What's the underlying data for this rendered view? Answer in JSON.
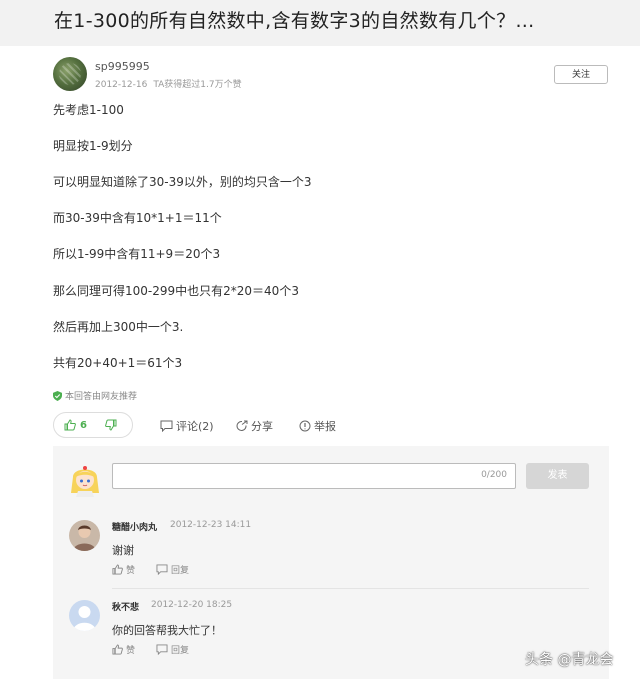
{
  "question": {
    "title": "在1-300的所有自然数中,含有数字3的自然数有几个？..."
  },
  "author": {
    "name": "sp995995",
    "date": "2012-12-16",
    "stats": "TA获得超过1.7万个赞"
  },
  "follow_label": "关注",
  "answer_lines": [
    "先考虑1-100",
    "明显按1-9划分",
    "可以明显知道除了30-39以外，别的均只含一个3",
    "而30-39中含有10*1+1＝11个",
    "所以1-99中含有11+9＝20个3",
    "那么同理可得100-299中也只有2*20＝40个3",
    "然后再加上300中一个3.",
    "共有20+40+1＝61个3"
  ],
  "recommend_note": "本回答由网友推荐",
  "votes": {
    "up_count": "6"
  },
  "actions": {
    "comment": "评论(2)",
    "share": "分享",
    "report": "举报"
  },
  "comment_box": {
    "counter": "0/200",
    "submit": "发表"
  },
  "comments": [
    {
      "user": "糖醋小肉丸",
      "time": "2012-12-23 14:11",
      "text": "谢谢",
      "like": "赞",
      "reply": "回复"
    },
    {
      "user": "秋不悲",
      "time": "2012-12-20 18:25",
      "text": "你的回答帮我大忙了！",
      "like": "赞",
      "reply": "回复"
    }
  ],
  "watermark": "头条 @青龙会"
}
